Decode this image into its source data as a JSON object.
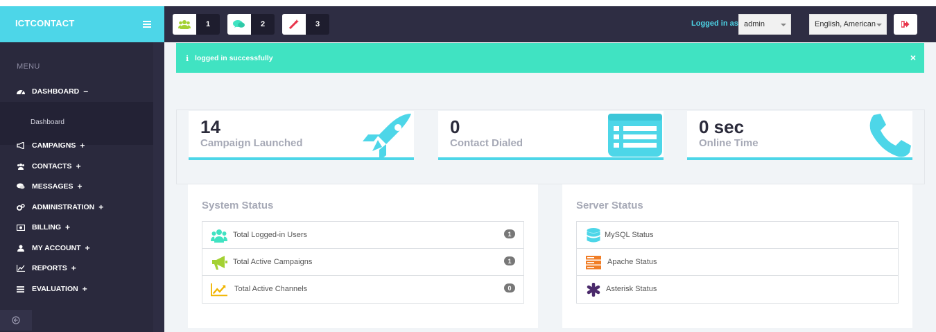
{
  "brand": {
    "title": "ICTCONTACT"
  },
  "header": {
    "notifications": [
      {
        "icon": "users-icon",
        "count": "1"
      },
      {
        "icon": "chat-icon",
        "count": "2"
      },
      {
        "icon": "magic-wand-icon",
        "count": "3"
      }
    ],
    "logged_in_label": "Logged in as :",
    "user_select": "admin",
    "language_select": "English, American"
  },
  "sidebar": {
    "menu_heading": "MENU",
    "items": [
      {
        "label": "DASHBOARD",
        "toggle": "−",
        "icon": "dashboard-icon"
      },
      {
        "label": "CAMPAIGNS",
        "toggle": "+",
        "icon": "bullhorn-icon"
      },
      {
        "label": "CONTACTS",
        "toggle": "+",
        "icon": "users-icon"
      },
      {
        "label": "MESSAGES",
        "toggle": "+",
        "icon": "chat-icon"
      },
      {
        "label": "ADMINISTRATION",
        "toggle": "+",
        "icon": "cogs-icon"
      },
      {
        "label": "BILLING",
        "toggle": "+",
        "icon": "money-icon"
      },
      {
        "label": "MY ACCOUNT",
        "toggle": "+",
        "icon": "user-icon"
      },
      {
        "label": "REPORTS",
        "toggle": "+",
        "icon": "chart-icon"
      },
      {
        "label": "EVALUATION",
        "toggle": "+",
        "icon": "list-icon"
      }
    ],
    "submenu": {
      "dashboard": "Dashboard"
    }
  },
  "alert": {
    "message": "logged in successfully",
    "close": "×"
  },
  "stats": [
    {
      "value": "14",
      "label": "Campaign Launched",
      "icon": "rocket-icon"
    },
    {
      "value": "0",
      "label": "Contact Dialed",
      "icon": "list-card-icon"
    },
    {
      "value": "0 sec",
      "label": "Online Time",
      "icon": "phone-icon"
    }
  ],
  "system_status": {
    "title": "System Status",
    "rows": [
      {
        "label": "Total Logged-in Users",
        "badge": "1",
        "icon": "users-icon",
        "color": "#40e3c2"
      },
      {
        "label": "Total Active Campaigns",
        "badge": "1",
        "icon": "bullhorn-icon",
        "color": "#a3d133"
      },
      {
        "label": "Total Active Channels",
        "badge": "0",
        "icon": "line-chart-icon",
        "color": "#f0b400"
      }
    ]
  },
  "server_status": {
    "title": "Server Status",
    "rows": [
      {
        "label": "MySQL Status",
        "icon": "database-icon",
        "color": "#4dd6e8"
      },
      {
        "label": "Apache Status",
        "icon": "server-icon",
        "color": "#f07d26"
      },
      {
        "label": "Asterisk Status",
        "icon": "asterisk-icon",
        "color": "#4b2a6b"
      }
    ]
  },
  "colors": {
    "accent": "#4dd6e8",
    "header": "#2e2d43",
    "sidebar": "#2a293d",
    "alert": "#40e3c2"
  }
}
